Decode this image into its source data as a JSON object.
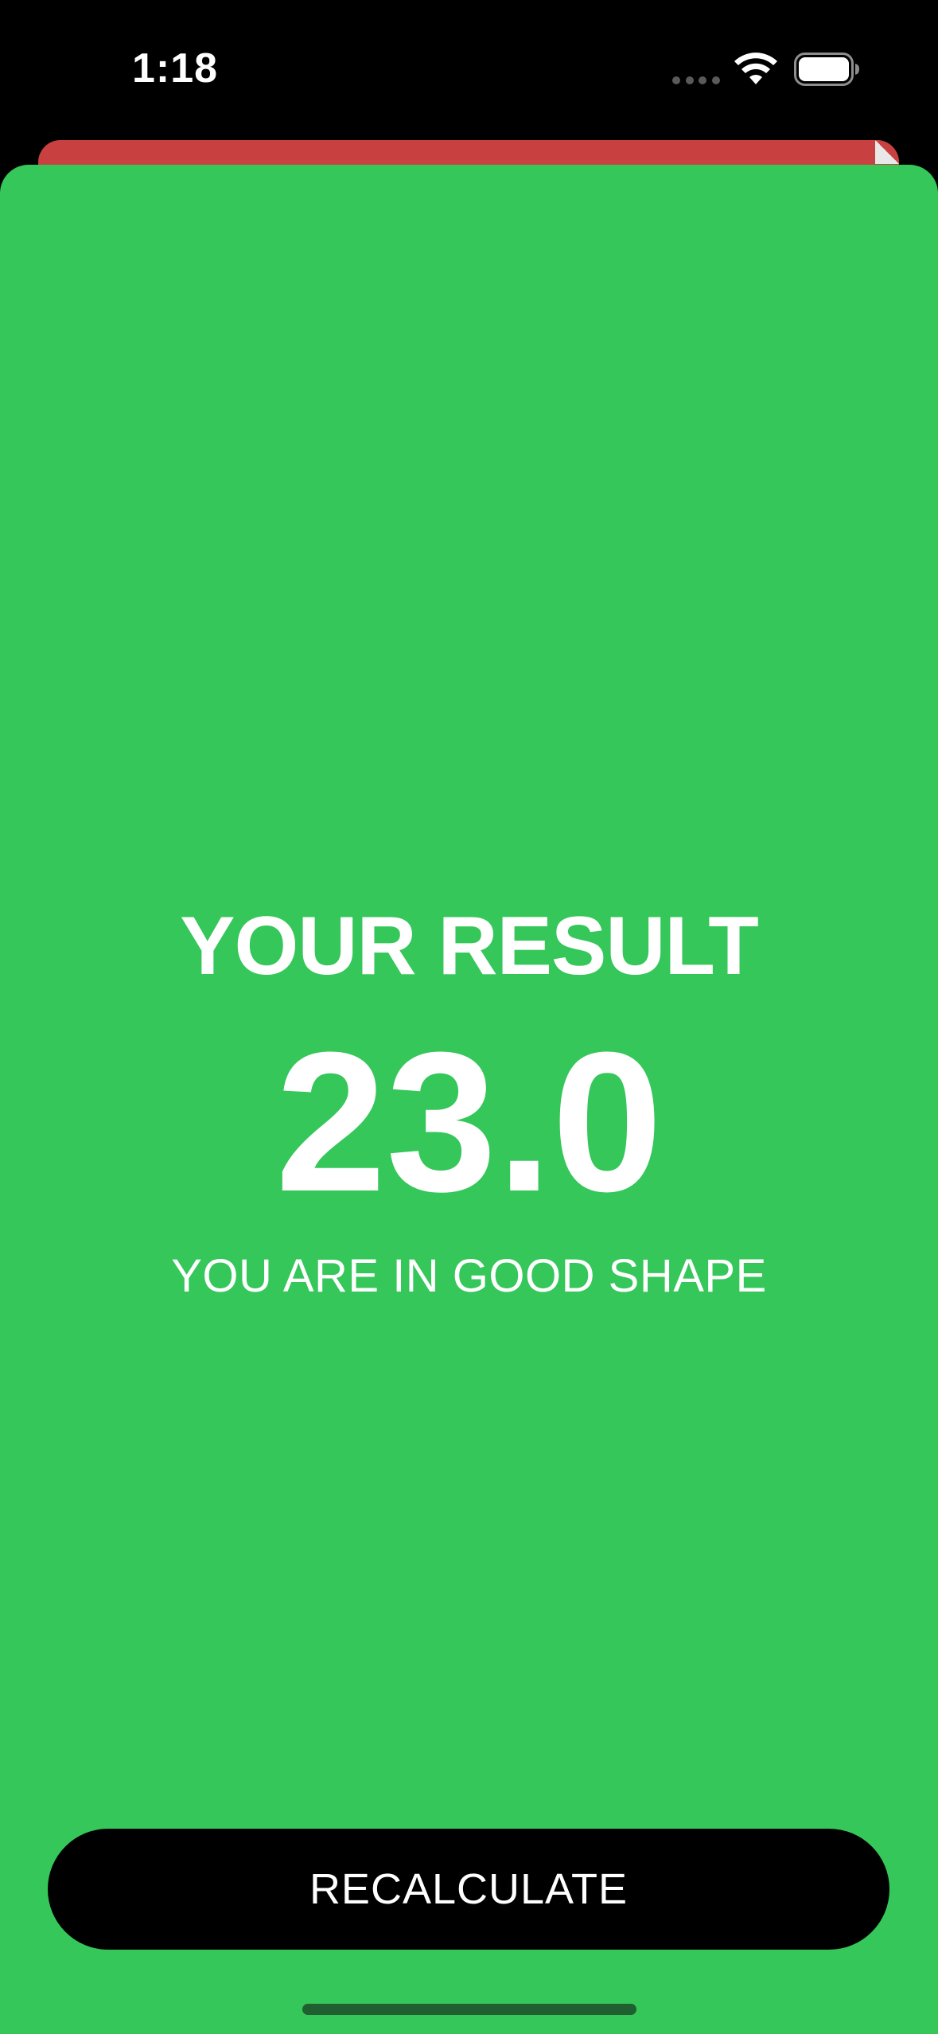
{
  "status_bar": {
    "time": "1:18",
    "icons": [
      "cellular-dots-icon",
      "wifi-icon",
      "battery-icon"
    ]
  },
  "colors": {
    "background_card": "#c94040",
    "sheet": "#35c75a",
    "button": "#000000",
    "text": "#ffffff"
  },
  "result": {
    "title": "YOUR RESULT",
    "value": "23.0",
    "advice": "YOU ARE IN GOOD SHAPE"
  },
  "actions": {
    "recalculate_label": "RECALCULATE"
  }
}
